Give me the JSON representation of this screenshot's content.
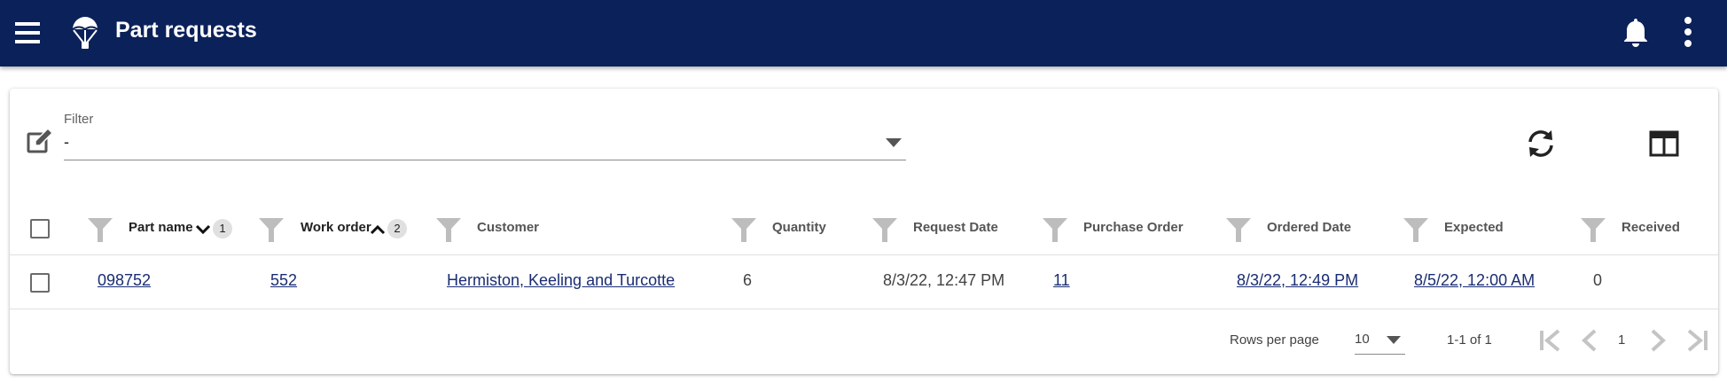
{
  "appbar": {
    "title": "Part requests",
    "icons": {
      "menu": "menu-icon",
      "logo": "parachute-icon",
      "notifications": "bell-icon",
      "more": "more-vert-icon"
    },
    "background": "#0b2159"
  },
  "filter": {
    "label": "Filter",
    "value": "-",
    "icons": {
      "edit": "edit-note-icon",
      "dropdown": "caret-down-icon",
      "refresh": "refresh-icon",
      "columns": "columns-icon"
    }
  },
  "table": {
    "columns": [
      {
        "label": "Part name",
        "sort": "desc",
        "sort_order": "1"
      },
      {
        "label": "Work order",
        "sort": "asc",
        "sort_order": "2"
      },
      {
        "label": "Customer"
      },
      {
        "label": "Quantity"
      },
      {
        "label": "Request Date"
      },
      {
        "label": "Purchase Order"
      },
      {
        "label": "Ordered Date"
      },
      {
        "label": "Expected"
      },
      {
        "label": "Received"
      }
    ],
    "rows": [
      {
        "part_name": "098752",
        "work_order": "552",
        "customer": "Hermiston, Keeling and Turcotte",
        "quantity": "6",
        "request_date": "8/3/22, 12:47 PM",
        "purchase_order": "11",
        "ordered_date": "8/3/22, 12:49 PM",
        "expected": "8/5/22, 12:00 AM",
        "received": "0"
      }
    ],
    "link_color": "#1a2d73"
  },
  "pagination": {
    "rows_per_page_label": "Rows per page",
    "rows_per_page": "10",
    "range": "1-1 of 1",
    "current_page": "1",
    "icons": {
      "first": "first-page-icon",
      "prev": "chevron-left-icon",
      "next": "chevron-right-icon",
      "last": "last-page-icon"
    }
  }
}
